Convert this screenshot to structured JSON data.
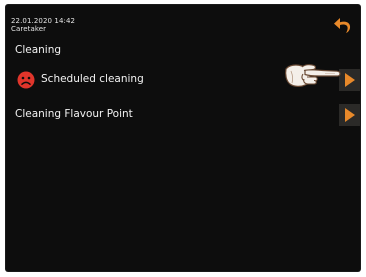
{
  "header": {
    "timestamp": "22.01.2020 14:42",
    "user": "Caretaker"
  },
  "page": {
    "title": "Cleaning"
  },
  "items": [
    {
      "label": "Scheduled cleaning",
      "status_icon": "sad-face-icon",
      "status_color": "#e0352b"
    },
    {
      "label": "Cleaning Flavour Point"
    }
  ],
  "icons": {
    "back": "back-arrow-icon",
    "next": "play-arrow-icon",
    "pointer": "pointing-hand-icon"
  },
  "colors": {
    "background": "#0d0d0d",
    "accent": "#e8892a",
    "text": "#f2f2f2",
    "button_bg": "#2b2a28"
  }
}
